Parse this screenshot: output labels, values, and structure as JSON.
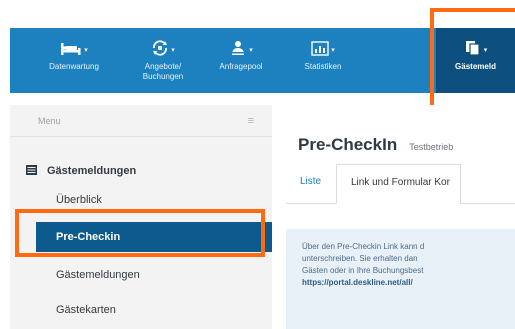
{
  "nav": {
    "items": [
      {
        "label": "Datenwartung",
        "icon": "bed-icon"
      },
      {
        "label": "Angebote/\nBuchungen",
        "icon": "cycle-icon"
      },
      {
        "label": "Anfragepool",
        "icon": "users-icon"
      },
      {
        "label": "Statistiken",
        "icon": "chart-icon"
      },
      {
        "label": "Gästemeld",
        "icon": "documents-icon"
      }
    ]
  },
  "sidebar": {
    "menu_label": "Menu",
    "section_title": "Gästemeldungen",
    "items": [
      {
        "label": "Überblick"
      },
      {
        "label": "Pre-Checkin"
      },
      {
        "label": "Gästemeldungen"
      },
      {
        "label": "Gästekarten"
      }
    ]
  },
  "main": {
    "title": "Pre-CheckIn",
    "subtitle": "Testbetrieb",
    "tabs": [
      {
        "label": "Liste"
      },
      {
        "label": "Link und Formular Kor"
      }
    ],
    "info_lines": [
      "Über den Pre-Checkin Link kann d",
      "unterschreiben. Sie erhalten dan",
      "Gästen oder in Ihre Buchungsbest",
      "https://portal.deskline.net/all/"
    ]
  },
  "colors": {
    "navbar": "#1d80bf",
    "navbar_active": "#0d4f7f",
    "sidebar_active": "#0d5b8e",
    "highlight": "#ff6a13",
    "info_bg": "#e8f1f8"
  }
}
